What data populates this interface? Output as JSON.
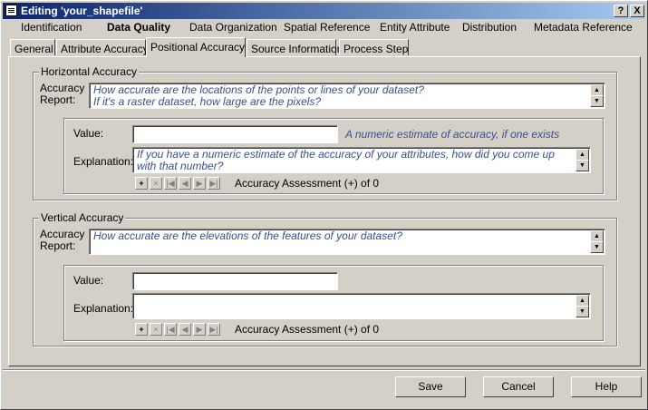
{
  "window": {
    "title": "Editing 'your_shapefile'",
    "help_button": "?",
    "close_button": "X"
  },
  "menu": [
    {
      "label": "Identification",
      "active": false
    },
    {
      "label": "Data Quality",
      "active": true
    },
    {
      "label": "Data Organization",
      "active": false
    },
    {
      "label": "Spatial Reference",
      "active": false
    },
    {
      "label": "Entity Attribute",
      "active": false
    },
    {
      "label": "Distribution",
      "active": false
    },
    {
      "label": "Metadata Reference",
      "active": false
    }
  ],
  "tabs": [
    {
      "label": "General",
      "active": false
    },
    {
      "label": "Attribute Accuracy",
      "active": false
    },
    {
      "label": "Positional Accuracy",
      "active": true
    },
    {
      "label": "Source Information",
      "active": false
    },
    {
      "label": "Process Step",
      "active": false
    }
  ],
  "horizontal": {
    "legend": "Horizontal Accuracy",
    "report_label_1": "Accuracy",
    "report_label_2": "Report:",
    "report_line_1": "How accurate are the locations of the points or lines of your dataset?",
    "report_line_2": "If it's a raster dataset, how large are the pixels?",
    "value_label": "Value:",
    "value": "",
    "value_hint": "A numeric estimate of accuracy, if one exists",
    "explanation_label": "Explanation:",
    "explanation_line_1": "If you have a numeric estimate of the accuracy of your attributes, how did you come up",
    "explanation_line_2": "with that number?",
    "nav_text": "Accuracy Assessment (+) of 0"
  },
  "vertical": {
    "legend": "Vertical Accuracy",
    "report_label_1": "Accuracy",
    "report_label_2": "Report:",
    "report_line_1": "How accurate are the elevations of the features of your dataset?",
    "value_label": "Value:",
    "value": "",
    "explanation_label": "Explanation:",
    "explanation_line_1": "",
    "nav_text": "Accuracy Assessment (+) of 0"
  },
  "nav": {
    "add": "+",
    "delete": "×",
    "first": "|◀",
    "prev": "◀",
    "next": "▶",
    "last": "▶|"
  },
  "buttons": {
    "save": "Save",
    "cancel": "Cancel",
    "help": "Help"
  }
}
